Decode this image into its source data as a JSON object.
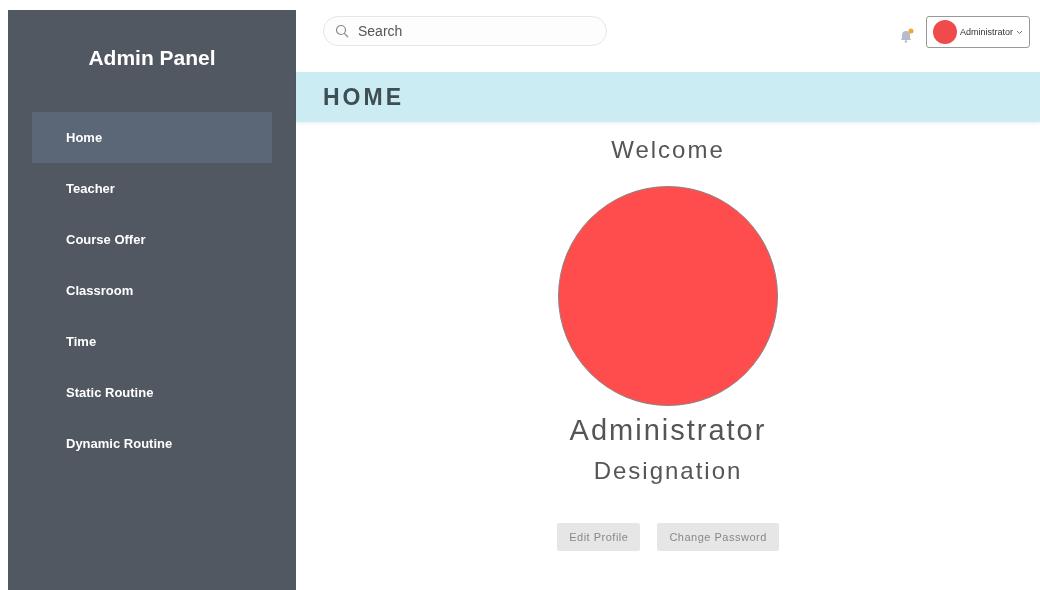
{
  "sidebar": {
    "title": "Admin Panel",
    "items": [
      {
        "label": "Home",
        "selected": true
      },
      {
        "label": "Teacher",
        "selected": false
      },
      {
        "label": "Course Offer",
        "selected": false
      },
      {
        "label": "Classroom",
        "selected": false
      },
      {
        "label": "Time",
        "selected": false
      },
      {
        "label": "Static Routine",
        "selected": false
      },
      {
        "label": "Dynamic Routine",
        "selected": false
      }
    ]
  },
  "search": {
    "placeholder": "Search"
  },
  "notifications": {
    "unread": true
  },
  "user_menu": {
    "name": "Administrator"
  },
  "page_title": "HOME",
  "profile": {
    "welcome": "Welcome",
    "name": "Administrator",
    "designation": "Designation"
  },
  "buttons": [
    "Edit Profile",
    "Change Password"
  ]
}
